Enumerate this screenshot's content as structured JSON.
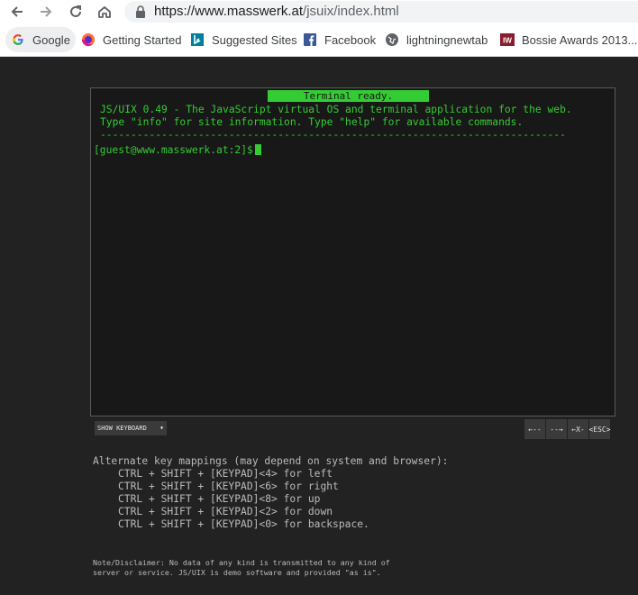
{
  "browser": {
    "url_host": "https://www.masswerk.at",
    "url_path": "/jsuix/index.html",
    "bookmarks": [
      {
        "label": "Google",
        "icon": "google-icon"
      },
      {
        "label": "Getting Started",
        "icon": "firefox-icon"
      },
      {
        "label": "Suggested Sites",
        "icon": "bing-icon"
      },
      {
        "label": "Facebook",
        "icon": "facebook-icon"
      },
      {
        "label": "lightningnewtab",
        "icon": "globe-icon"
      },
      {
        "label": "Bossie Awards 2013...",
        "icon": "infoworld-icon"
      }
    ]
  },
  "terminal": {
    "status": "Terminal ready.",
    "lines": [
      "JS/UIX 0.49 - The JavaScript virtual OS and terminal application for the web.",
      "Type \"info\" for site information. Type \"help\" for available commands.",
      "----------------------------------------------------------------------------"
    ],
    "prompt": "[guest@www.masswerk.at:2]$"
  },
  "controls": {
    "show_keyboard": "SHOW KEYBOARD",
    "caret": "▾",
    "keys": [
      "←--",
      "--→",
      "←X-",
      "<ESC>"
    ]
  },
  "help": {
    "title": "Alternate key mappings (may depend on system and browser):",
    "mappings": [
      "CTRL + SHIFT + [KEYPAD]<4> for left",
      "CTRL + SHIFT + [KEYPAD]<6> for right",
      "CTRL + SHIFT + [KEYPAD]<8> for up",
      "CTRL + SHIFT + [KEYPAD]<2> for down",
      "CTRL + SHIFT + [KEYPAD]<0> for backspace."
    ]
  },
  "note": {
    "line1": "Note/Disclaimer: No data of any kind is transmitted to any kind of",
    "line2": "server or service. JS/UIX is demo software and provided \"as is\"."
  },
  "colors": {
    "terminal_green": "#33cc33",
    "background": "#222222"
  }
}
